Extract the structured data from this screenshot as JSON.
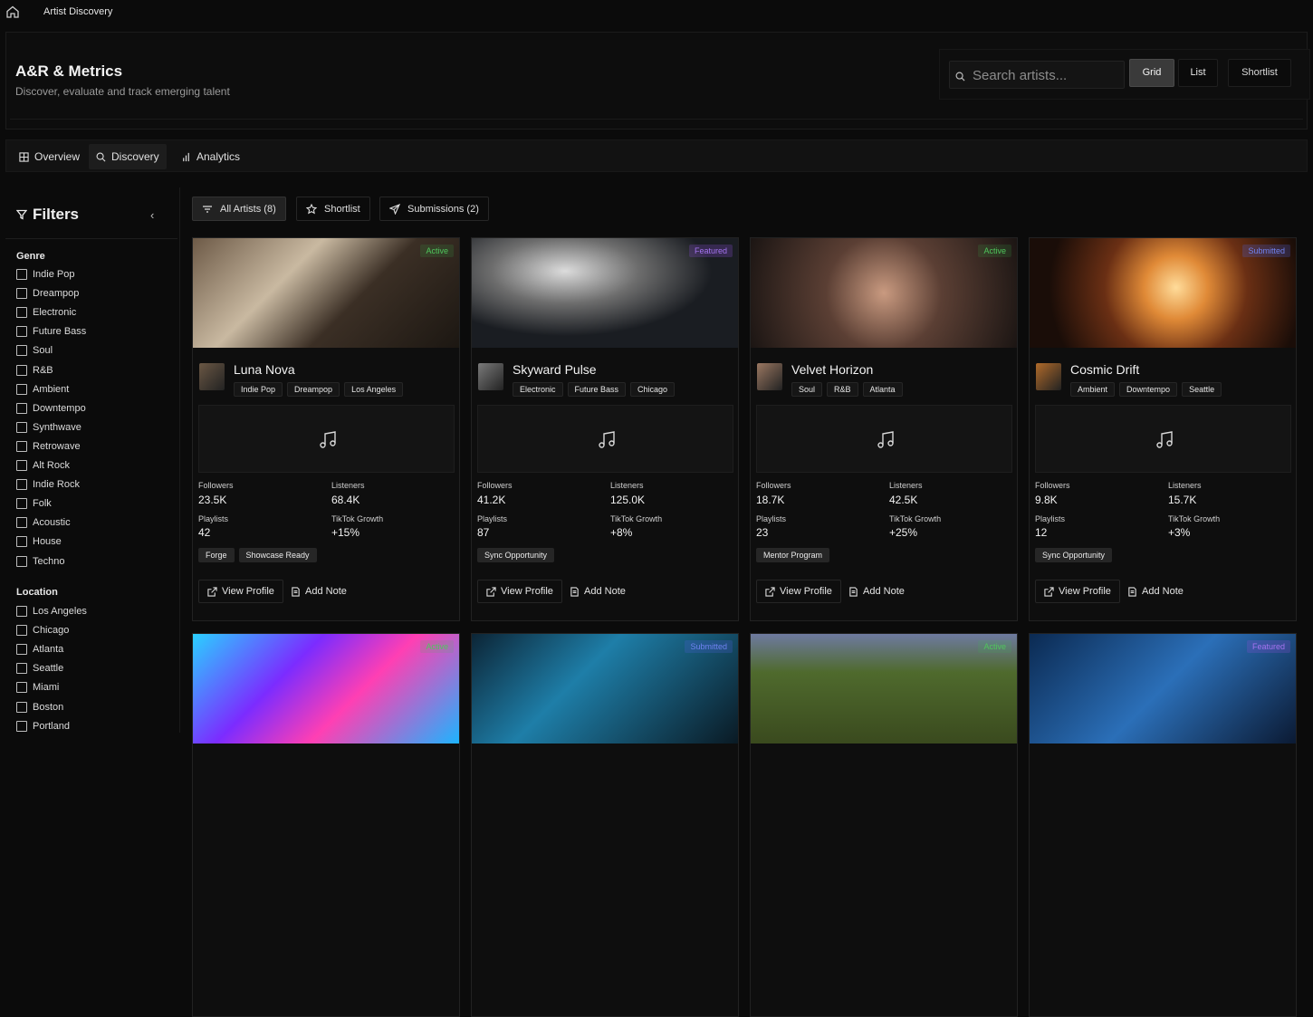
{
  "breadcrumb": {
    "page": "Artist Discovery"
  },
  "header": {
    "title": "A&R & Metrics",
    "subtitle": "Discover, evaluate and track emerging talent"
  },
  "toolbar": {
    "search_placeholder": "Search artists...",
    "grid_label": "Grid",
    "list_label": "List",
    "shortlist_label": "Shortlist"
  },
  "tabs": [
    {
      "label": "Overview"
    },
    {
      "label": "Discovery"
    },
    {
      "label": "Analytics"
    }
  ],
  "filters": {
    "title": "Filters",
    "genre_label": "Genre",
    "genres": [
      "Indie Pop",
      "Dreampop",
      "Electronic",
      "Future Bass",
      "Soul",
      "R&B",
      "Ambient",
      "Downtempo",
      "Synthwave",
      "Retrowave",
      "Alt Rock",
      "Indie Rock",
      "Folk",
      "Acoustic",
      "House",
      "Techno"
    ],
    "location_label": "Location",
    "locations": [
      "Los Angeles",
      "Chicago",
      "Atlanta",
      "Seattle",
      "Miami",
      "Boston",
      "Portland"
    ]
  },
  "view_chips": {
    "all": "All Artists (8)",
    "shortlist": "Shortlist",
    "submissions": "Submissions (2)"
  },
  "stat_labels": {
    "followers": "Followers",
    "listeners": "Listeners",
    "playlists": "Playlists",
    "tiktok": "TikTok Growth"
  },
  "actions": {
    "view_profile": "View Profile",
    "add_note": "Add Note"
  },
  "status_colors": {
    "active": "#3fbf4f",
    "featured": "#8a4fd6",
    "submitted": "#4a5fd8"
  },
  "artists": [
    {
      "name": "Luna Nova",
      "status": "Active",
      "tags": [
        "Indie Pop",
        "Dreampop",
        "Los Angeles"
      ],
      "followers": "23.5K",
      "listeners": "68.4K",
      "playlists": "42",
      "tiktok": "+15%",
      "pills": [
        "Forge",
        "Showcase Ready"
      ]
    },
    {
      "name": "Skyward Pulse",
      "status": "Featured",
      "tags": [
        "Electronic",
        "Future Bass",
        "Chicago"
      ],
      "followers": "41.2K",
      "listeners": "125.0K",
      "playlists": "87",
      "tiktok": "+8%",
      "pills": [
        "Sync Opportunity"
      ]
    },
    {
      "name": "Velvet Horizon",
      "status": "Active",
      "tags": [
        "Soul",
        "R&B",
        "Atlanta"
      ],
      "followers": "18.7K",
      "listeners": "42.5K",
      "playlists": "23",
      "tiktok": "+25%",
      "pills": [
        "Mentor Program"
      ]
    },
    {
      "name": "Cosmic Drift",
      "status": "Submitted",
      "tags": [
        "Ambient",
        "Downtempo",
        "Seattle"
      ],
      "followers": "9.8K",
      "listeners": "15.7K",
      "playlists": "12",
      "tiktok": "+3%",
      "pills": [
        "Sync Opportunity"
      ]
    },
    {
      "status": "Active"
    },
    {
      "status": "Submitted"
    },
    {
      "status": "Active"
    },
    {
      "status": "Featured"
    }
  ]
}
